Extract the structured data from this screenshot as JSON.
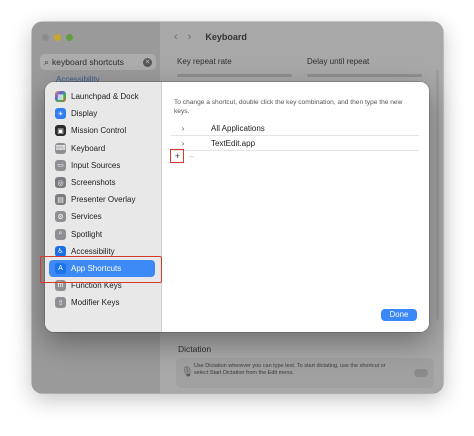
{
  "background_window": {
    "search": {
      "value": "keyboard shortcuts"
    },
    "peek_item": "Accessibility",
    "header": {
      "back": "‹",
      "forward": "›",
      "title": "Keyboard"
    },
    "key_repeat_label": "Key repeat rate",
    "delay_label": "Delay until repeat",
    "dictation": {
      "title": "Dictation",
      "description": "Use Dictation wherever you can type text. To start dictating, use the shortcut or select Start Dictation from the Edit menu."
    }
  },
  "sheet": {
    "sidebar": {
      "items": [
        {
          "label": "Launchpad & Dock",
          "icon": "launchpad-icon",
          "glyph": "▦"
        },
        {
          "label": "Display",
          "icon": "display-icon",
          "glyph": "☀"
        },
        {
          "label": "Mission Control",
          "icon": "mission-control-icon",
          "glyph": "▣"
        },
        {
          "label": "Keyboard",
          "icon": "keyboard-icon",
          "glyph": "⌨"
        },
        {
          "label": "Input Sources",
          "icon": "input-sources-icon",
          "glyph": "▭"
        },
        {
          "label": "Screenshots",
          "icon": "screenshots-icon",
          "glyph": "◎"
        },
        {
          "label": "Presenter Overlay",
          "icon": "presenter-overlay-icon",
          "glyph": "▤"
        },
        {
          "label": "Services",
          "icon": "services-icon",
          "glyph": "⚙"
        },
        {
          "label": "Spotlight",
          "icon": "spotlight-icon",
          "glyph": "⌕"
        },
        {
          "label": "Accessibility",
          "icon": "accessibility-icon",
          "glyph": "♿"
        },
        {
          "label": "App Shortcuts",
          "icon": "app-shortcuts-icon",
          "glyph": "A",
          "selected": true
        },
        {
          "label": "Function Keys",
          "icon": "function-keys-icon",
          "glyph": "fn"
        },
        {
          "label": "Modifier Keys",
          "icon": "modifier-keys-icon",
          "glyph": "⇧"
        }
      ]
    },
    "instructions": "To change a shortcut, double click the key combination, and then type the new keys.",
    "shortcut_rows": [
      {
        "chevron": "›",
        "name": "All Applications"
      },
      {
        "chevron": "›",
        "name": "TextEdit.app"
      }
    ],
    "add_button": "+",
    "remove_button": "–",
    "done_button": "Done"
  },
  "colors": {
    "accent": "#3a87f7",
    "highlight": "#d9392b"
  }
}
